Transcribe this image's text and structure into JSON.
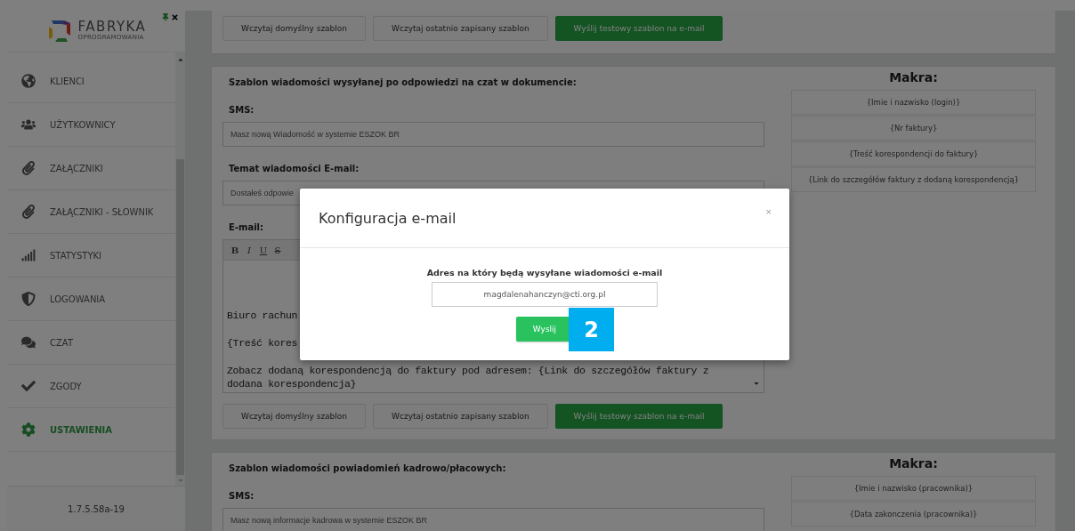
{
  "sidebar": {
    "logo": {
      "name": "FABRYKA",
      "tagline": "OPROGRAMOWANIA"
    },
    "items": [
      {
        "label": "KLIENCI",
        "selected": false
      },
      {
        "label": "UŻYTKOWNICY",
        "selected": false
      },
      {
        "label": "ZAŁĄCZNIKI",
        "selected": false
      },
      {
        "label": "ZAŁĄCZNIKI - SŁOWNIK",
        "selected": false
      },
      {
        "label": "STATYSTYKI",
        "selected": false
      },
      {
        "label": "LOGOWANIA",
        "selected": false
      },
      {
        "label": "CZAT",
        "selected": false
      },
      {
        "label": "ZGODY",
        "selected": false
      },
      {
        "label": "USTAWIENIA",
        "selected": true
      }
    ],
    "version": "1.7.5.58a-19"
  },
  "top_panel": {
    "buttons": [
      {
        "label": "Wczytaj domyślny szablon",
        "kind": "default"
      },
      {
        "label": "Wczytaj ostatnio zapisany szablon",
        "kind": "default"
      },
      {
        "label": "Wyślij testowy szablon na e-mail",
        "kind": "primary"
      }
    ]
  },
  "sections": [
    {
      "title": "Szablon wiadomości wysyłanej po odpowiedzi na czat w dokumencie:",
      "fields": [
        {
          "kind": "input",
          "label": "SMS:",
          "value": "Masz nową Wiadomość w systemie ESZOK BR"
        },
        {
          "kind": "input",
          "label": "Temat wiadomości E-mail:",
          "value": "Dostałeś odpowie"
        },
        {
          "kind": "editor",
          "label": "E-mail:",
          "toolbar": [
            "B",
            "I",
            "U",
            "S"
          ],
          "paragraphs": [
            "Biuro rachun",
            "{Treść kores",
            "Zobacz dodaną korespondencją do faktury pod adresem: {Link do szczegółów faktury z dodana korespondencja}"
          ]
        }
      ],
      "buttons": [
        {
          "label": "Wczytaj domyślny szablon",
          "kind": "default"
        },
        {
          "label": "Wczytaj ostatnio zapisany szablon",
          "kind": "default"
        },
        {
          "label": "Wyślij testowy szablon na e-mail",
          "kind": "primary"
        }
      ],
      "macros_title": "Makra:",
      "macros": [
        "{Imie i nazwisko (login)}",
        "{Nr faktury}",
        "{Treść korespondencji do faktury}",
        "{Link do szczegółów faktury z dodaną korespondencją}"
      ]
    },
    {
      "title": "Szablon wiadomości powiadomień kadrowo/płacowych:",
      "fields": [
        {
          "kind": "input",
          "label": "SMS:",
          "value": "Masz nową informacje kadrowa w systemie ESZOK BR"
        }
      ],
      "macros_title": "Makra:",
      "macros": [
        "{Imie i nazwisko (pracownika)}",
        "{Data zakonczenia (pracownika)}"
      ]
    }
  ],
  "modal": {
    "title": "Konfiguracja e-mail",
    "close": "×",
    "field_label": "Adres na który będą wysyłane wiadomości e-mail",
    "email": "magdalenahanczyn@cti.org.pl",
    "submit": "Wyslij",
    "step_badge": "2"
  }
}
